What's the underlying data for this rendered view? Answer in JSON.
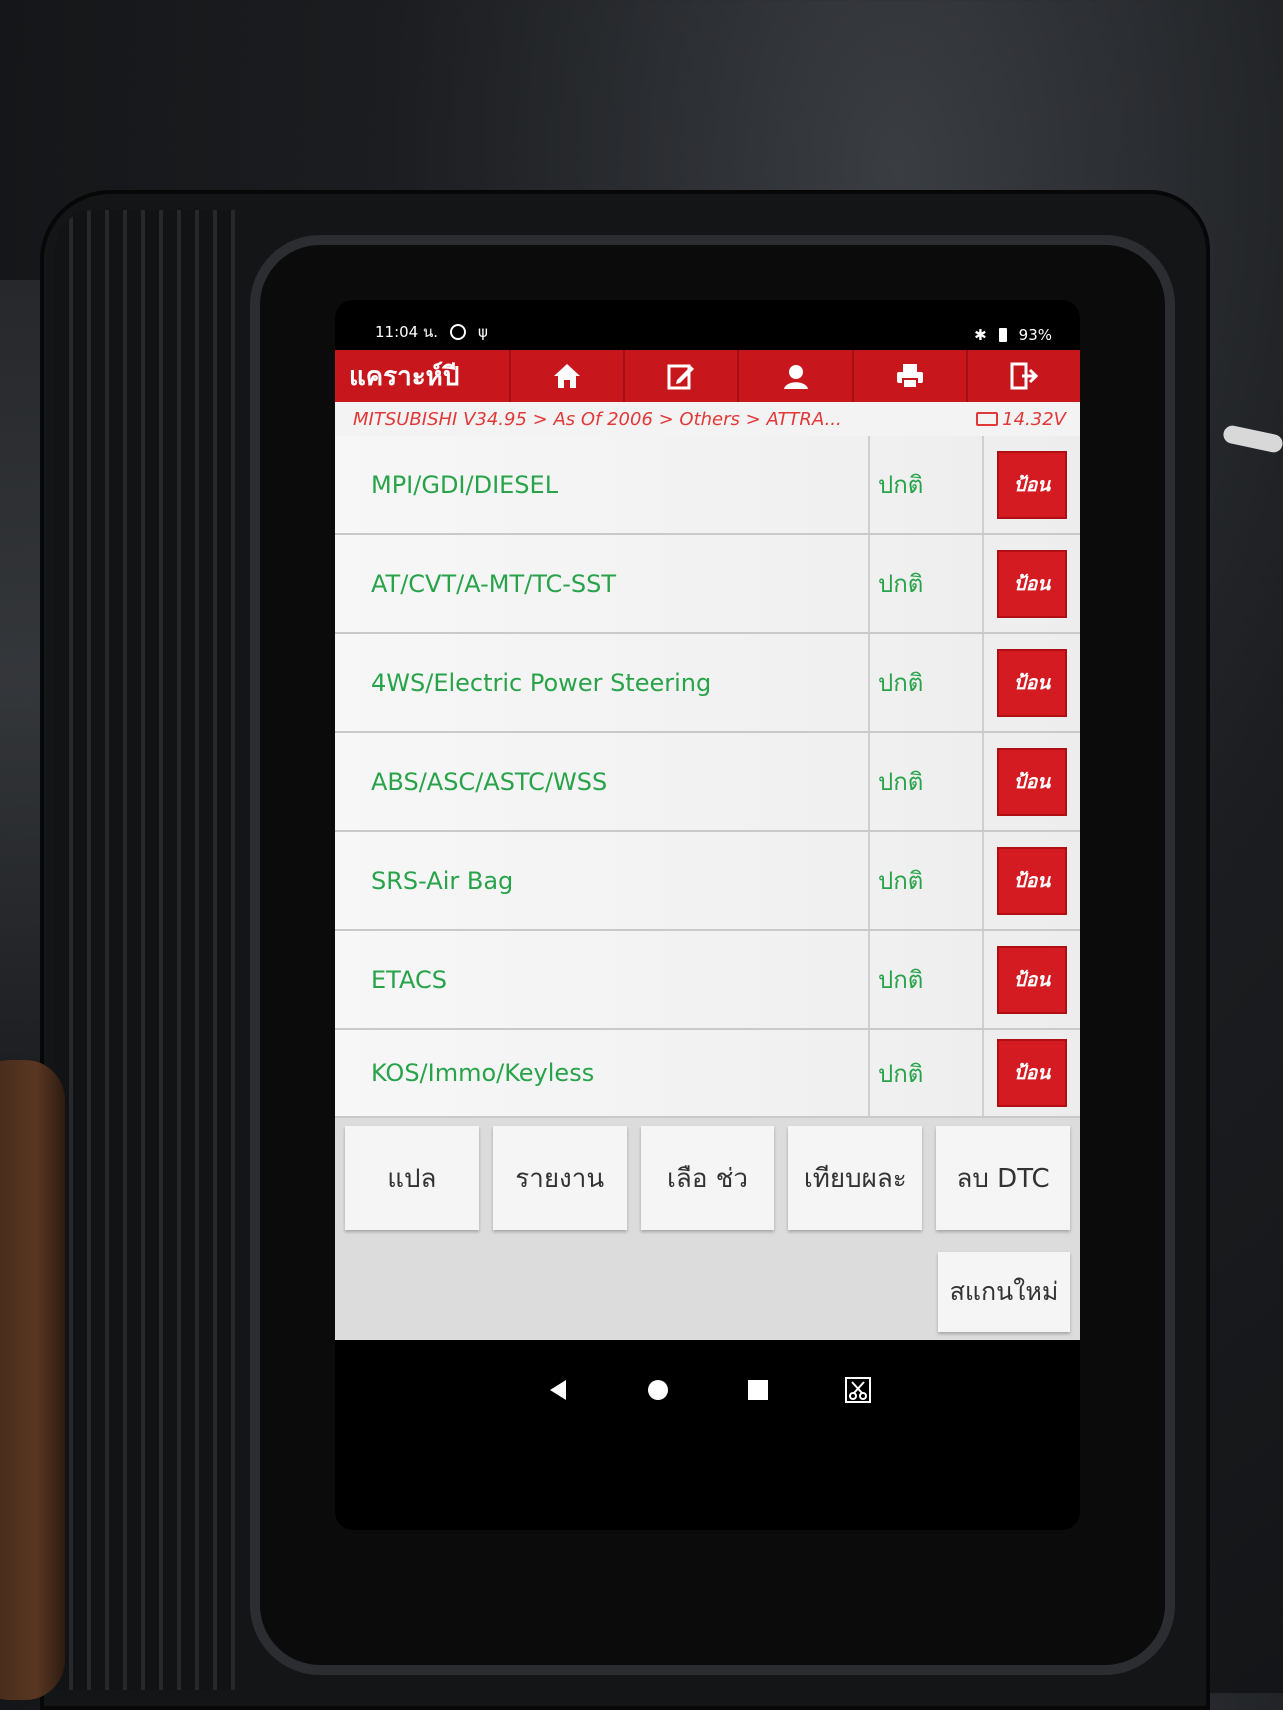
{
  "status_bar": {
    "time": "11:04 น.",
    "battery": "93%"
  },
  "app_bar": {
    "title": "แคราะห์ปี",
    "icons": [
      "home-icon",
      "edit-icon",
      "user-icon",
      "print-icon",
      "exit-icon"
    ]
  },
  "breadcrumb": {
    "path": "MITSUBISHI V34.95 > As Of 2006 > Others > ATTRA...",
    "voltage": "14.32V"
  },
  "systems": [
    {
      "name": "MPI/GDI/DIESEL",
      "status": "ปกติ",
      "button": "ป้อน"
    },
    {
      "name": "AT/CVT/A-MT/TC-SST",
      "status": "ปกติ",
      "button": "ป้อน"
    },
    {
      "name": "4WS/Electric Power Steering",
      "status": "ปกติ",
      "button": "ป้อน"
    },
    {
      "name": "ABS/ASC/ASTC/WSS",
      "status": "ปกติ",
      "button": "ป้อน"
    },
    {
      "name": "SRS-Air Bag",
      "status": "ปกติ",
      "button": "ป้อน"
    },
    {
      "name": "ETACS",
      "status": "ปกติ",
      "button": "ป้อน"
    },
    {
      "name": "KOS/Immo/Keyless",
      "status": "ปกติ",
      "button": "ป้อน"
    }
  ],
  "actions": {
    "translate": "แปล",
    "report": "รายงาน",
    "select_help": "เลือ    ช่ว",
    "compare": "เทียบผละ",
    "clear_dtc": "ลบ DTC",
    "rescan": "สแกนใหม่"
  },
  "colors": {
    "accent_red": "#c8161d",
    "ok_green": "#29a34a"
  }
}
